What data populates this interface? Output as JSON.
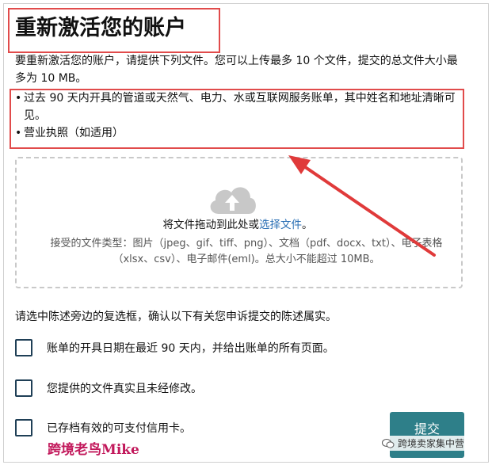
{
  "page": {
    "title": "重新激活您的账户",
    "intro": "要重新激活您的账户，请提供下列文件。您可以上传最多 10 个文件，提交的总文件大小最多为 10 MB。"
  },
  "requirements": [
    "过去 90 天内开具的管道或天然气、电力、水或互联网服务账单，其中姓名和地址清晰可见。",
    "营业执照（如适用）"
  ],
  "dropzone": {
    "icon": "cloud-upload-icon",
    "main_text_prefix": "将文件拖动到此处或",
    "choose_link": "选择文件",
    "main_text_suffix": "。",
    "accepted_types": "接受的文件类型：图片（jpeg、gif、tiff、png）、文档（pdf、docx、txt）、电子表格（xlsx、csv）、电子邮件(eml)。总大小不能超过 10MB。"
  },
  "confirm_prompt": "请选中陈述旁边的复选框，确认以下有关您申诉提交的陈述属实。",
  "checkboxes": [
    {
      "label": "账单的开具日期在最近 90 天内，并给出账单的所有页面。",
      "checked": false
    },
    {
      "label": "您提供的文件真实且未经修改。",
      "checked": false
    },
    {
      "label": "已存档有效的可支付信用卡。",
      "checked": false
    }
  ],
  "submit_label": "提交",
  "watermarks": {
    "left": "跨境老鸟Mike",
    "right": "跨境卖家集中营"
  },
  "colors": {
    "highlight_red": "#e14b4b",
    "submit_bg": "#2e7f89",
    "link": "#2a6fb4",
    "checkbox_border": "#1f3f56"
  }
}
